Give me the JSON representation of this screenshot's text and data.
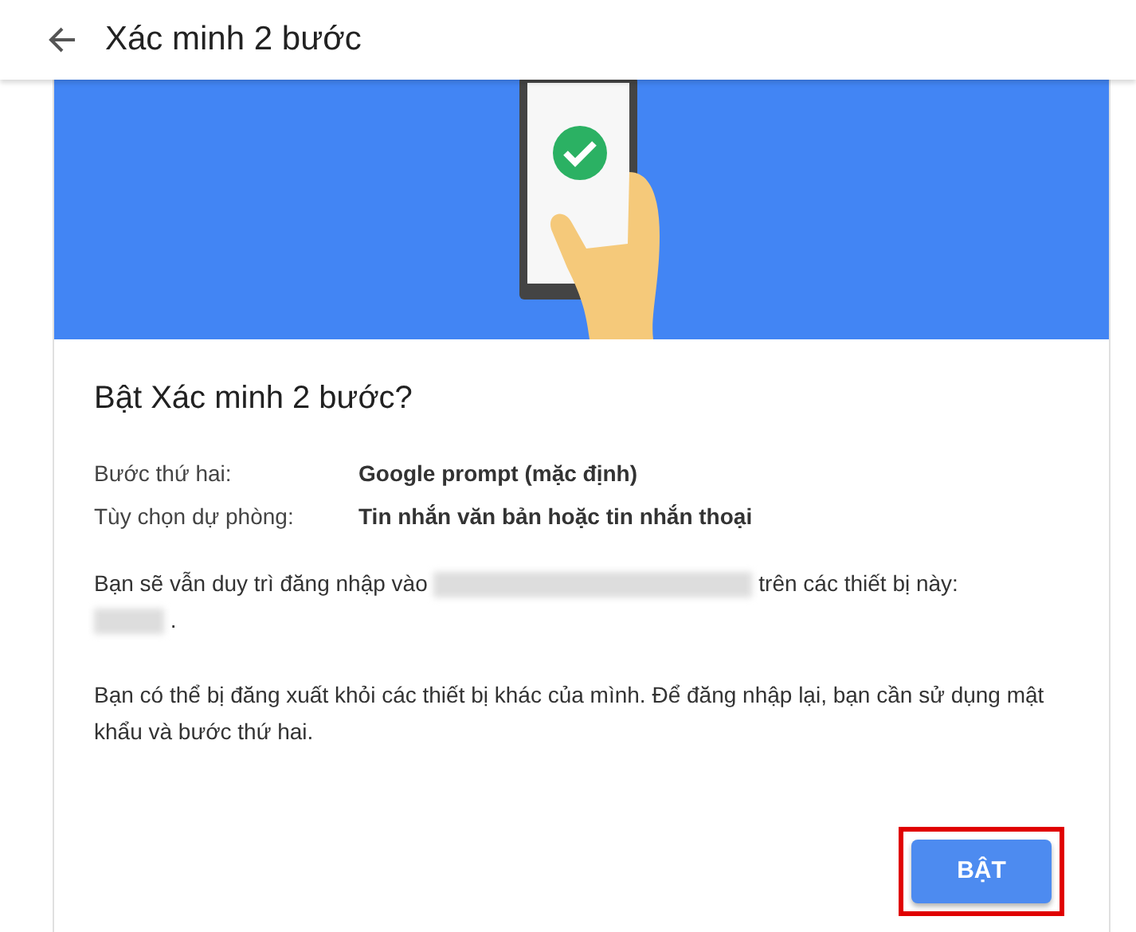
{
  "header": {
    "title": "Xác minh 2 bước"
  },
  "dialog": {
    "heading": "Bật Xác minh 2 bước?",
    "settings": [
      {
        "label": "Bước thứ hai:",
        "value": "Google prompt (mặc định)"
      },
      {
        "label": "Tùy chọn dự phòng:",
        "value": "Tin nhắn văn bản hoặc tin nhắn thoại"
      }
    ],
    "session_note": {
      "before": "Bạn sẽ vẫn duy trì đăng nhập vào",
      "after": "trên các thiết bị này:",
      "end": "."
    },
    "signout_note": "Bạn có thể bị đăng xuất khỏi các thiết bị khác của mình. Để đăng nhập lại, bạn cần sử dụng mật khẩu và bước thứ hai.",
    "button": {
      "label": "BẬT",
      "highlighted": true
    }
  }
}
